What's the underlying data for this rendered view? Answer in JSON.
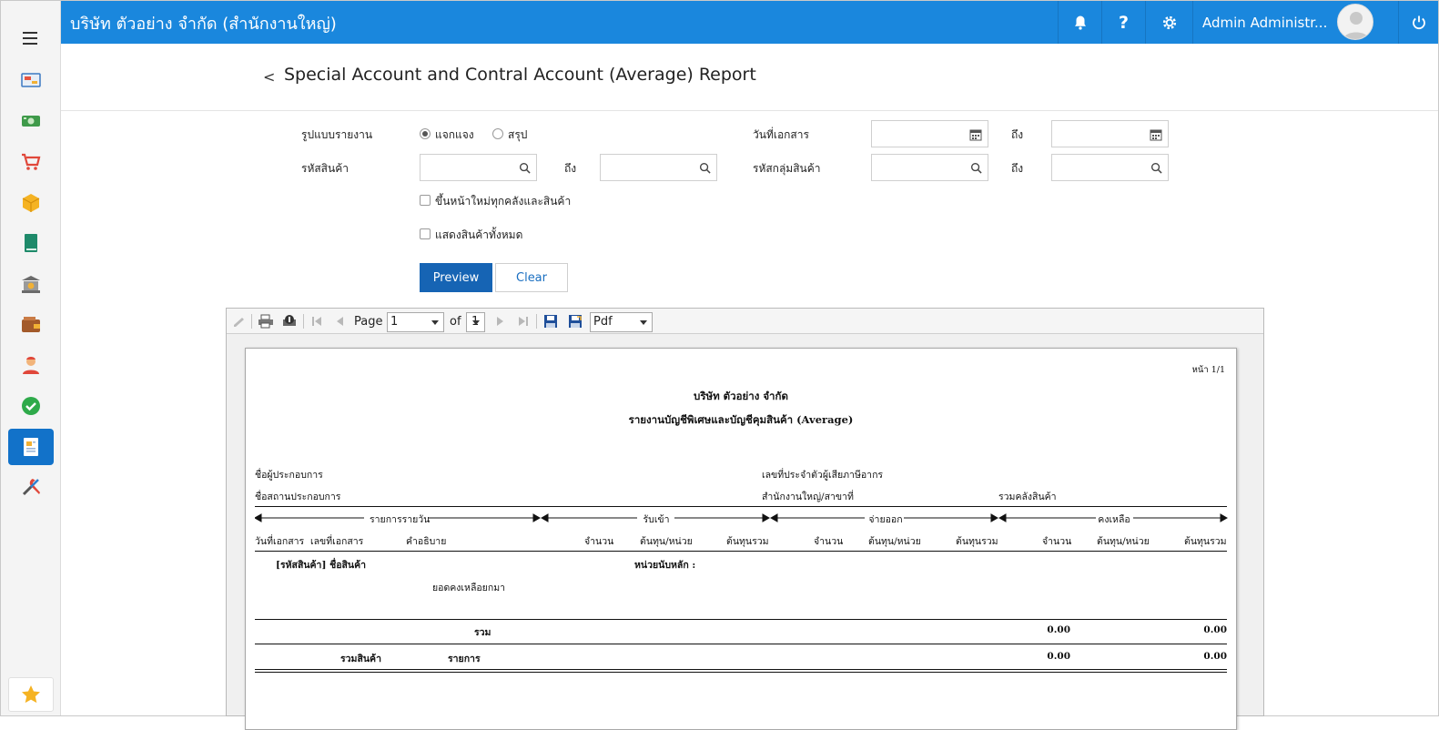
{
  "topbar": {
    "company": "บริษัท ตัวอย่าง จำกัด (สำนักงานใหญ่)",
    "user": "Admin Administr...",
    "help_glyph": "?",
    "icons": [
      "bell-icon",
      "help-icon",
      "gear-icon",
      "avatar",
      "power-icon"
    ],
    "color": "#1a87dd"
  },
  "sidebar": {
    "items": [
      "dashboard-icon",
      "money-icon",
      "cart-icon",
      "box-icon",
      "book-icon",
      "bank-icon",
      "wallet-icon",
      "user-icon",
      "check-icon",
      "report-icon",
      "tools-icon"
    ],
    "active_index": 9,
    "favorite_icon": "star-icon"
  },
  "page": {
    "back_glyph": "<",
    "title": "Special Account and Contral Account (Average) Report"
  },
  "form": {
    "report_type_label": "รูปแบบรายงาน",
    "option_detail": "แจกแจง",
    "option_summary": "สรุป",
    "selected_option": "แจกแจง",
    "doc_date_label": "วันที่เอกสาร",
    "to_label": "ถึง",
    "product_code_label": "รหัสสินค้า",
    "product_group_label": "รหัสกลุ่มสินค้า",
    "new_page_label": "ขึ้นหน้าใหม่ทุกคลังและสินค้า",
    "show_all_label": "แสดงสินค้าทั้งหมด",
    "preview_label": "Preview",
    "clear_label": "Clear"
  },
  "viewer": {
    "page_label": "Page",
    "page_value": "1",
    "of_label": "of",
    "total_pages": "1",
    "format": "Pdf"
  },
  "report": {
    "page_no": "หน้า 1/1",
    "company": "บริษัท ตัวอย่าง จำกัด",
    "title": "รายงานบัญชีพิเศษและบัญชีคุมสินค้า (Average)",
    "operator_label": "ชื่อผู้ประกอบการ",
    "tax_id_label": "เลขที่ประจำตัวผู้เสียภาษีอากร",
    "place_label": "ชื่อสถานประกอบการ",
    "branch_label": "สำนักงานใหญ่/สาขาที่",
    "warehouse_label": "รวมคลังสินค้า",
    "groups": [
      "รายการรายวัน",
      "รับเข้า",
      "จ่ายออก",
      "คงเหลือ"
    ],
    "columns": [
      "วันที่เอกสาร",
      "เลขที่เอกสาร",
      "คำอธิบาย",
      "จำนวน",
      "ต้นทุน/หน่วย",
      "ต้นทุนรวม",
      "จำนวน",
      "ต้นทุน/หน่วย",
      "ต้นทุนรวม",
      "จำนวน",
      "ต้นทุน/หน่วย",
      "ต้นทุนรวม"
    ],
    "product_label": "[รหัสสินค้า] ชื่อสินค้า",
    "unit_label": "หน่วยนับหลัก :",
    "carry_forward": "ยอดคงเหลือยกมา",
    "total_label": "รวม",
    "total_qty": "0.00",
    "total_cost": "0.00",
    "grand_label": "รวมสินค้า",
    "items_label": "รายการ",
    "grand_qty": "0.00",
    "grand_cost": "0.00"
  }
}
